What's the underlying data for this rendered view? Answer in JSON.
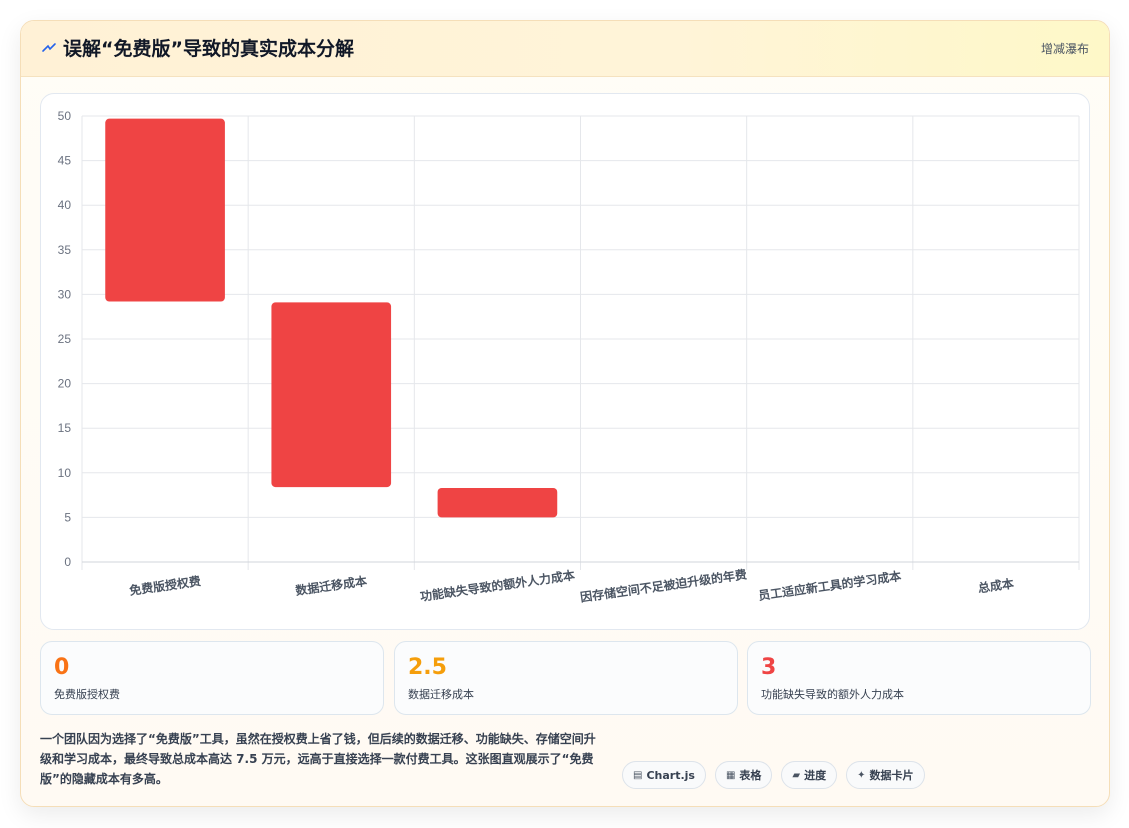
{
  "header": {
    "icon": "zigzag-icon",
    "title": "误解“免费版”导致的真实成本分解",
    "chart_type_label": "增减瀑布"
  },
  "chart_data": {
    "type": "bar",
    "subtype": "waterfall",
    "categories": [
      "免费版授权费",
      "数据迁移成本",
      "功能缺失导致的额外人力成本",
      "因存储空间不足被迫升级的年费",
      "员工适应新工具的学习成本",
      "总成本"
    ],
    "ranges": [
      [
        29.2,
        49.7
      ],
      [
        8.4,
        29.1
      ],
      [
        5.0,
        8.3
      ],
      null,
      null,
      null
    ],
    "ylim": [
      0,
      50
    ],
    "yticks": [
      0,
      5,
      10,
      15,
      20,
      25,
      30,
      35,
      40,
      45,
      50
    ],
    "grid": true,
    "legend": "none",
    "bar_color": "#ef4444",
    "grid_color": "#e5e7eb",
    "tick_color": "#6b7280"
  },
  "stats": [
    {
      "value": "0",
      "label": "免费版授权费",
      "color": "#f97316"
    },
    {
      "value": "2.5",
      "label": "数据迁移成本",
      "color": "#f59e0b"
    },
    {
      "value": "3",
      "label": "功能缺失导致的额外人力成本",
      "color": "#ef4444"
    }
  ],
  "description": "一个团队因为选择了“免费版”工具，虽然在授权费上省了钱，但后续的数据迁移、功能缺失、存储空间升级和学习成本，最终导致总成本高达 7.5 万元，远高于直接选择一款付费工具。这张图直观展示了“免费版”的隐藏成本有多高。",
  "tags": [
    {
      "icon": "chart-icon",
      "glyph": "▤",
      "label": "Chart.js"
    },
    {
      "icon": "table-icon",
      "glyph": "▦",
      "label": "表格"
    },
    {
      "icon": "progress-icon",
      "glyph": "▰",
      "label": "进度"
    },
    {
      "icon": "card-icon",
      "glyph": "✦",
      "label": "数据卡片"
    }
  ]
}
